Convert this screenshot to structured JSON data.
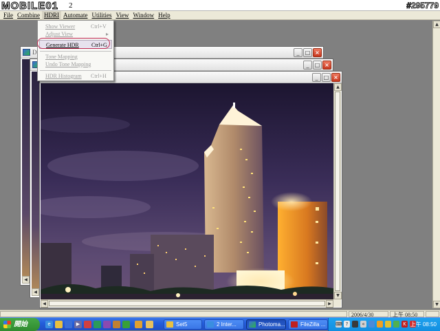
{
  "watermark": {
    "logo": "MOBILE01",
    "logo_extra": "2",
    "post_id": "#295779"
  },
  "menu": [
    {
      "label": "File"
    },
    {
      "label": "Combine"
    },
    {
      "label": "HDRI",
      "active": true
    },
    {
      "label": "Automate"
    },
    {
      "label": "Utilities"
    },
    {
      "label": "View"
    },
    {
      "label": "Window"
    },
    {
      "label": "Help"
    }
  ],
  "hdri_menu": {
    "items": [
      {
        "label": "Show Viewer",
        "shortcut": "Ctrl+V",
        "disabled": true
      },
      {
        "label": "Adjust View",
        "shortcut": "▸",
        "disabled": true
      },
      {
        "label": "Generate HDR",
        "shortcut": "Ctrl+G",
        "disabled": false,
        "highlighted": true
      },
      {
        "label": "Tone Mapping",
        "shortcut": "",
        "disabled": true
      },
      {
        "label": "Undo Tone Mapping",
        "shortcut": "",
        "disabled": true
      },
      {
        "label": "HDR Histogram",
        "shortcut": "Ctrl+H",
        "disabled": true
      }
    ]
  },
  "windows": [
    {
      "caption": "D"
    },
    {
      "caption": ""
    },
    {
      "caption": ""
    }
  ],
  "status": {
    "date": "2006/4/30",
    "time": "上午 08:50"
  },
  "taskbar": {
    "start_label": "開始",
    "tasks": [
      {
        "label": "Set5"
      },
      {
        "label": "2 Inter..."
      },
      {
        "label": "Photoma...",
        "active": true
      },
      {
        "label": "FileZilla ..."
      }
    ],
    "language": "CH",
    "clock": "上午 08:50"
  },
  "colors": {
    "taskbar_blue": "#245edc",
    "start_green": "#2f8b2f",
    "menu_highlight_ring": "#c02a52",
    "close_button": "#c7371e"
  },
  "icons": {
    "window": "app-icon",
    "close": "close-icon",
    "minimize": "minimize-icon",
    "maximize": "maximize-icon"
  }
}
